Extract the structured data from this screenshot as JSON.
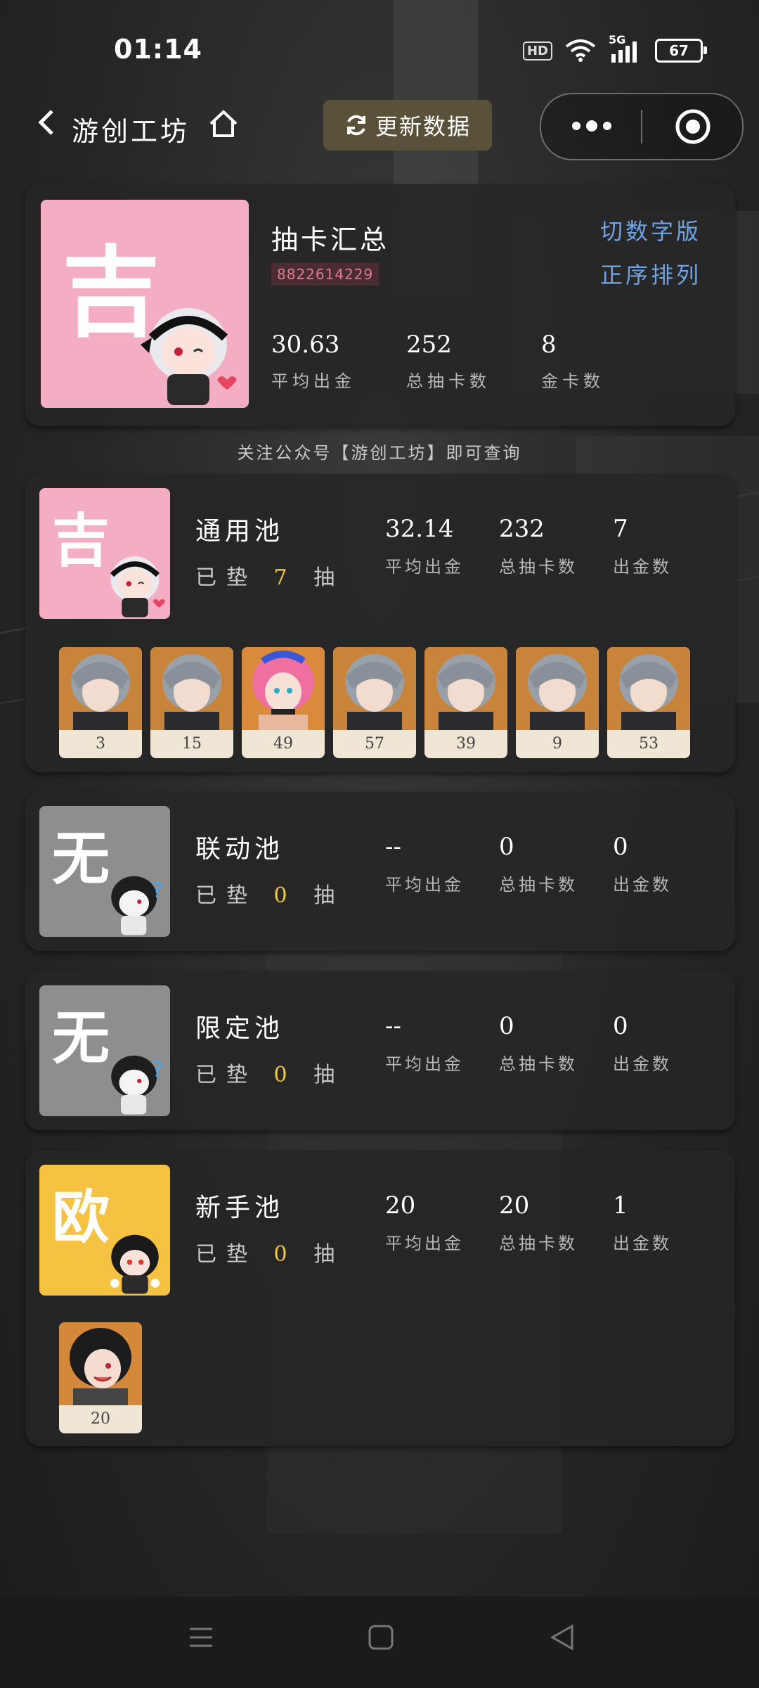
{
  "status_bar": {
    "time": "01:14",
    "hd": "HD",
    "network": "5G",
    "battery": "67"
  },
  "nav": {
    "title": "游创工坊",
    "update_button": "更新数据"
  },
  "summary": {
    "luck": "吉",
    "title": "抽卡汇总",
    "uid": "8822614229",
    "switch_link": "切数字版",
    "sort_link": "正序排列",
    "stats": [
      {
        "value": "30.63",
        "label": "平均出金"
      },
      {
        "value": "252",
        "label": "总抽卡数"
      },
      {
        "value": "8",
        "label": "金卡数"
      }
    ]
  },
  "hint": "关注公众号【游创工坊】即可查询",
  "pools": [
    {
      "luck": "吉",
      "luck_color": "#f4aec3",
      "name": "通用池",
      "pity_prefix": "已垫",
      "pity": "7",
      "pity_suffix": "抽",
      "stats": [
        {
          "value": "32.14",
          "label": "平均出金"
        },
        {
          "value": "232",
          "label": "总抽卡数"
        },
        {
          "value": "7",
          "label": "出金数"
        }
      ],
      "golds": [
        "3",
        "15",
        "49",
        "57",
        "39",
        "9",
        "53"
      ]
    },
    {
      "luck": "无",
      "luck_color": "#8e8e8e",
      "name": "联动池",
      "pity_prefix": "已垫",
      "pity": "0",
      "pity_suffix": "抽",
      "stats": [
        {
          "value": "--",
          "label": "平均出金"
        },
        {
          "value": "0",
          "label": "总抽卡数"
        },
        {
          "value": "0",
          "label": "出金数"
        }
      ],
      "golds": []
    },
    {
      "luck": "无",
      "luck_color": "#8e8e8e",
      "name": "限定池",
      "pity_prefix": "已垫",
      "pity": "0",
      "pity_suffix": "抽",
      "stats": [
        {
          "value": "--",
          "label": "平均出金"
        },
        {
          "value": "0",
          "label": "总抽卡数"
        },
        {
          "value": "0",
          "label": "出金数"
        }
      ],
      "golds": []
    },
    {
      "luck": "欧",
      "luck_color": "#f5c242",
      "name": "新手池",
      "pity_prefix": "已垫",
      "pity": "0",
      "pity_suffix": "抽",
      "stats": [
        {
          "value": "20",
          "label": "平均出金"
        },
        {
          "value": "20",
          "label": "总抽卡数"
        },
        {
          "value": "1",
          "label": "出金数"
        }
      ],
      "golds": [
        "20"
      ]
    }
  ],
  "colors": {
    "accent_link": "#6ea3e8",
    "pity_number": "#f2c93f",
    "uid_text": "#e07b8f",
    "button_bg": "#5a513a"
  }
}
